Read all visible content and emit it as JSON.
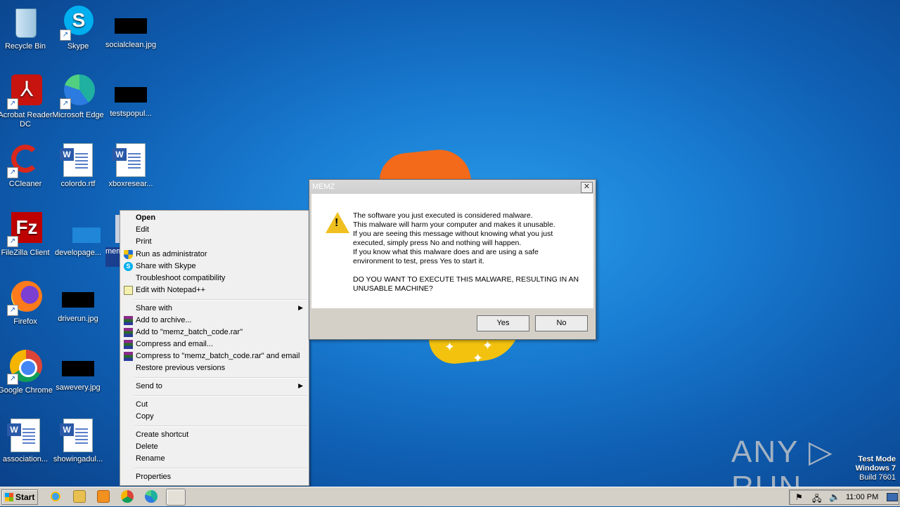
{
  "desktop_icons": {
    "recycle_bin": "Recycle Bin",
    "skype": "Skype",
    "socialclean": "socialclean.jpg",
    "acrobat": "Acrobat Reader DC",
    "edge": "Microsoft Edge",
    "testspopul": "testspopul...",
    "ccleaner": "CCleaner",
    "colordo": "colordo.rtf",
    "xboxresear": "xboxresear...",
    "filezilla": "FileZilla Client",
    "developage": "developage...",
    "memz_partial": "mem",
    "firefox": "Firefox",
    "driverun": "driverun.jpg",
    "chrome": "Google Chrome",
    "sawevery": "sawevery.jpg",
    "association": "association...",
    "showingadul": "showingadul..."
  },
  "context_menu": {
    "open": "Open",
    "edit": "Edit",
    "print": "Print",
    "run_admin": "Run as administrator",
    "share_skype": "Share with Skype",
    "troubleshoot": "Troubleshoot compatibility",
    "notepad": "Edit with Notepad++",
    "share_with": "Share with",
    "add_archive": "Add to archive...",
    "add_rar": "Add to \"memz_batch_code.rar\"",
    "compress_email": "Compress and email...",
    "compress_rar_email": "Compress to \"memz_batch_code.rar\" and email",
    "restore": "Restore previous versions",
    "send_to": "Send to",
    "cut": "Cut",
    "copy": "Copy",
    "create_shortcut": "Create shortcut",
    "delete": "Delete",
    "rename": "Rename",
    "properties": "Properties"
  },
  "dialog": {
    "title": "MEMZ",
    "close": "✕",
    "line1": "The software you just executed is considered malware.",
    "line2": "This malware will harm your computer and makes it unusable.",
    "line3": "If you are seeing this message without knowing what you just",
    "line4": "executed, simply press No and nothing will happen.",
    "line5": "If you know what this malware does and are using a safe",
    "line6": "environment to test, press Yes to start it.",
    "line7": "DO YOU WANT TO EXECUTE THIS MALWARE, RESULTING IN AN",
    "line8": "UNUSABLE MACHINE?",
    "yes": "Yes",
    "no": "No"
  },
  "taskbar": {
    "start": "Start",
    "clock": "11:00 PM"
  },
  "watermark": "ANY ▷ RUN",
  "test_mode": {
    "line1": "Test Mode",
    "line2": "Windows 7",
    "line3": "Build 7601"
  }
}
